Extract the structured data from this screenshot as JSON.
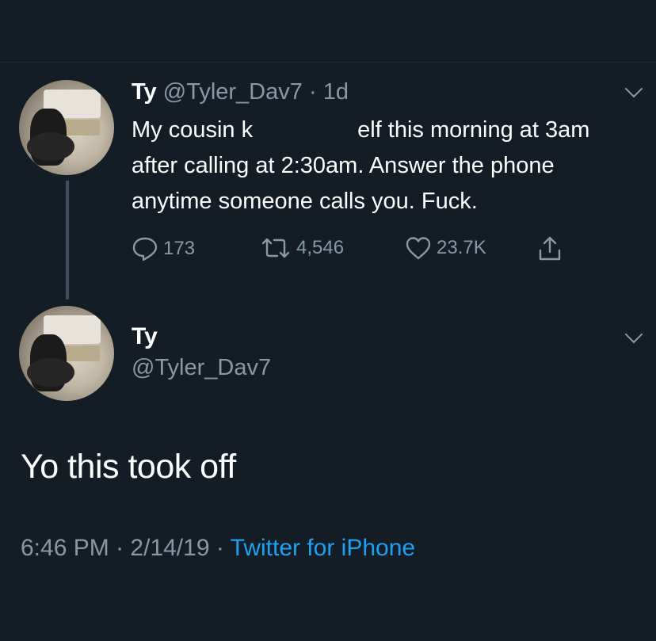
{
  "tweet": {
    "name": "Ty",
    "handle": "@Tyler_Dav7",
    "separator": "·",
    "age": "1d",
    "text_part1": "My cousin k",
    "text_part2": "elf this morning at 3am after calling at 2:30am. Answer the phone anytime someone calls you. Fuck.",
    "replies": "173",
    "retweets": "4,546",
    "likes": "23.7K"
  },
  "reply": {
    "name": "Ty",
    "handle": "@Tyler_Dav7",
    "text": "Yo this took off",
    "time": "6:46 PM",
    "date": "2/14/19",
    "separator": "·",
    "source": "Twitter for iPhone"
  },
  "colors": {
    "background": "#141d26",
    "secondary_text": "#8899a6",
    "link": "#1da1f2"
  },
  "icons": [
    "reply-icon",
    "retweet-icon",
    "like-icon",
    "share-icon",
    "chevron-down-icon"
  ]
}
